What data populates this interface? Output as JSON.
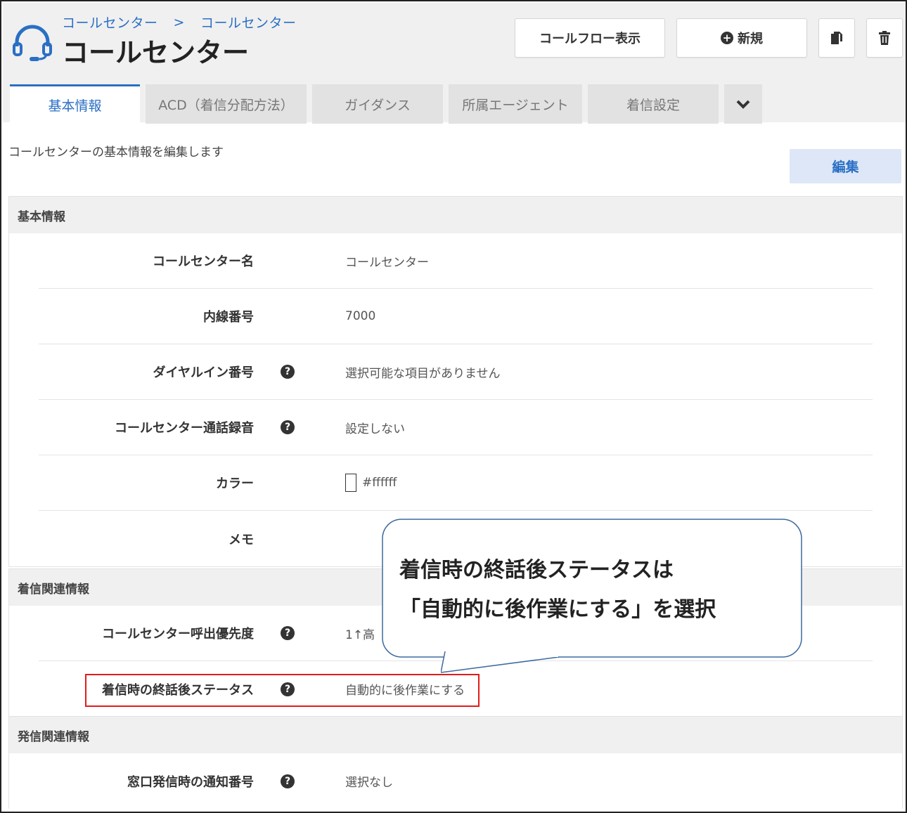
{
  "header": {
    "breadcrumb": [
      "コールセンター",
      "コールセンター"
    ],
    "breadcrumb_sep": ">",
    "title": "コールセンター",
    "buttons": {
      "flow": "コールフロー表示",
      "new": "新規"
    },
    "icons": [
      "headset-icon",
      "copy-icon",
      "trash-icon",
      "plus-circle-icon"
    ]
  },
  "tabs": [
    {
      "label": "基本情報",
      "active": true
    },
    {
      "label": "ACD（着信分配方法）",
      "active": false
    },
    {
      "label": "ガイダンス",
      "active": false
    },
    {
      "label": "所属エージェント",
      "active": false
    },
    {
      "label": "着信設定",
      "active": false
    }
  ],
  "intro": "コールセンターの基本情報を編集します",
  "edit_label": "編集",
  "sections": {
    "basic": {
      "title": "基本情報",
      "rows": [
        {
          "label": "コールセンター名",
          "value": "コールセンター",
          "help": false
        },
        {
          "label": "内線番号",
          "value": "7000",
          "help": false
        },
        {
          "label": "ダイヤルイン番号",
          "value": "選択可能な項目がありません",
          "help": true
        },
        {
          "label": "コールセンター通話録音",
          "value": "設定しない",
          "help": true
        },
        {
          "label": "カラー",
          "value": "#ffffff",
          "help": false
        },
        {
          "label": "メモ",
          "value": "",
          "help": false
        }
      ]
    },
    "incoming": {
      "title": "着信関連情報",
      "rows": [
        {
          "label": "コールセンター呼出優先度",
          "value": "1↑高",
          "help": true
        },
        {
          "label": "着信時の終話後ステータス",
          "value": "自動的に後作業にする",
          "help": true
        }
      ]
    },
    "outgoing": {
      "title": "発信関連情報",
      "rows": [
        {
          "label": "窓口発信時の通知番号",
          "value": "選択なし",
          "help": true
        }
      ]
    }
  },
  "help_glyph": "?",
  "callout": {
    "line1": "着信時の終話後ステータスは",
    "line2": "「自動的に後作業にする」を選択"
  },
  "colors": {
    "accent": "#2a6fc4",
    "highlight": "#e31b1b",
    "callout_border": "#3d6a9e"
  }
}
